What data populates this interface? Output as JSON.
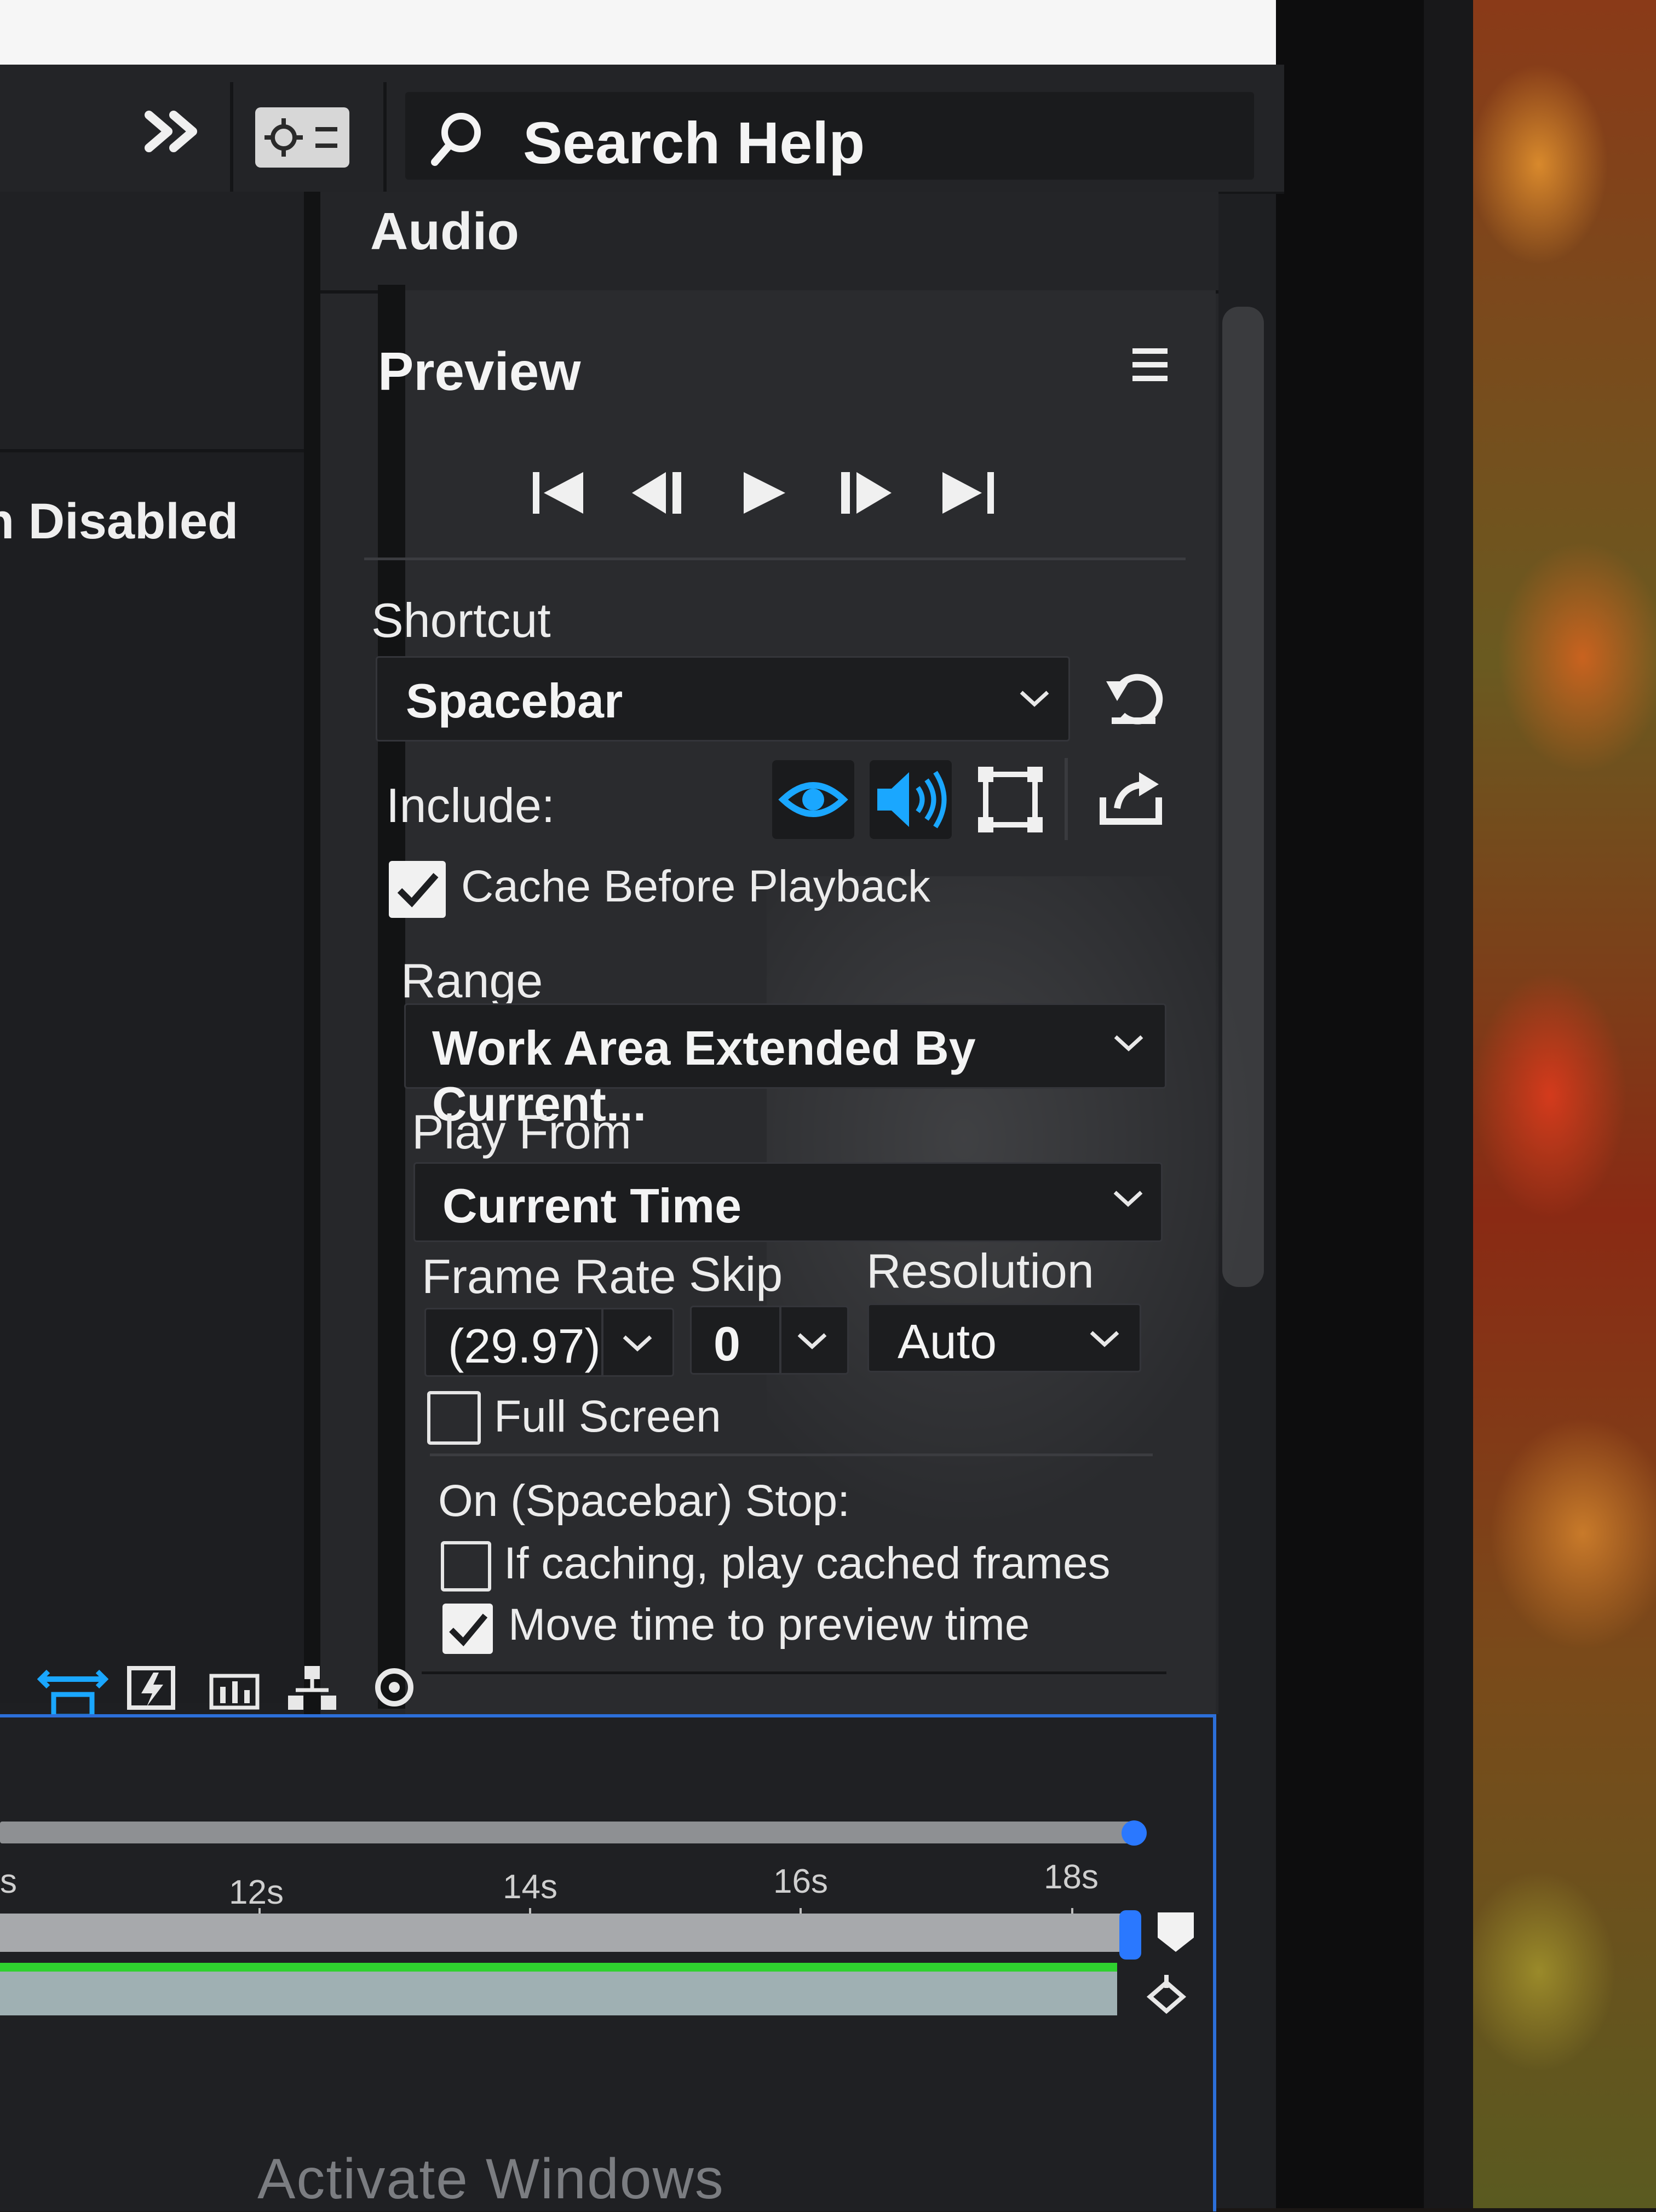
{
  "toolbar": {
    "overflow_icon": "double-chevron-right-icon",
    "workspace_icon": "workspace-settings-icon",
    "search_icon": "search-icon",
    "search_label": "Search Help"
  },
  "left_panel": {
    "status_text": "n Disabled"
  },
  "audio_panel": {
    "title": "Audio"
  },
  "preview_panel": {
    "title": "Preview",
    "menu_icon": "hamburger-menu-icon",
    "transport": [
      "first-frame-icon",
      "previous-frame-icon",
      "play-icon",
      "next-frame-icon",
      "last-frame-icon"
    ],
    "shortcut_label": "Shortcut",
    "shortcut_value": "Spacebar",
    "reset_icon": "reset-icon",
    "include_label": "Include:",
    "include_icons": [
      "eye-icon",
      "speaker-icon",
      "overlays-icon"
    ],
    "export_icon": "export-icon",
    "cache_label": "Cache Before Playback",
    "cache_checked": true,
    "range_label": "Range",
    "range_value": "Work Area Extended By Current...",
    "play_from_label": "Play From",
    "play_from_value": "Current Time",
    "frame_rate_label": "Frame Rate",
    "frame_rate_value": "(29.97)",
    "skip_label": "Skip",
    "skip_value": "0",
    "resolution_label": "Resolution",
    "resolution_value": "Auto",
    "full_screen_label": "Full Screen",
    "full_screen_checked": false,
    "on_stop_label": "On (Spacebar) Stop:",
    "if_caching_label": "If caching, play cached frames",
    "if_caching_checked": false,
    "move_time_label": "Move time to preview time",
    "move_time_checked": true
  },
  "bottom_tools": [
    "swap-icon",
    "flowchart-icon"
  ],
  "timeline": {
    "ticks": [
      "s",
      "12s",
      "14s",
      "16s",
      "18s"
    ]
  },
  "watermark": "Activate Windows",
  "colors": {
    "accent_blue": "#2a78ff",
    "active_cyan": "#1aa7ff",
    "green_bar": "#2fd12f"
  }
}
